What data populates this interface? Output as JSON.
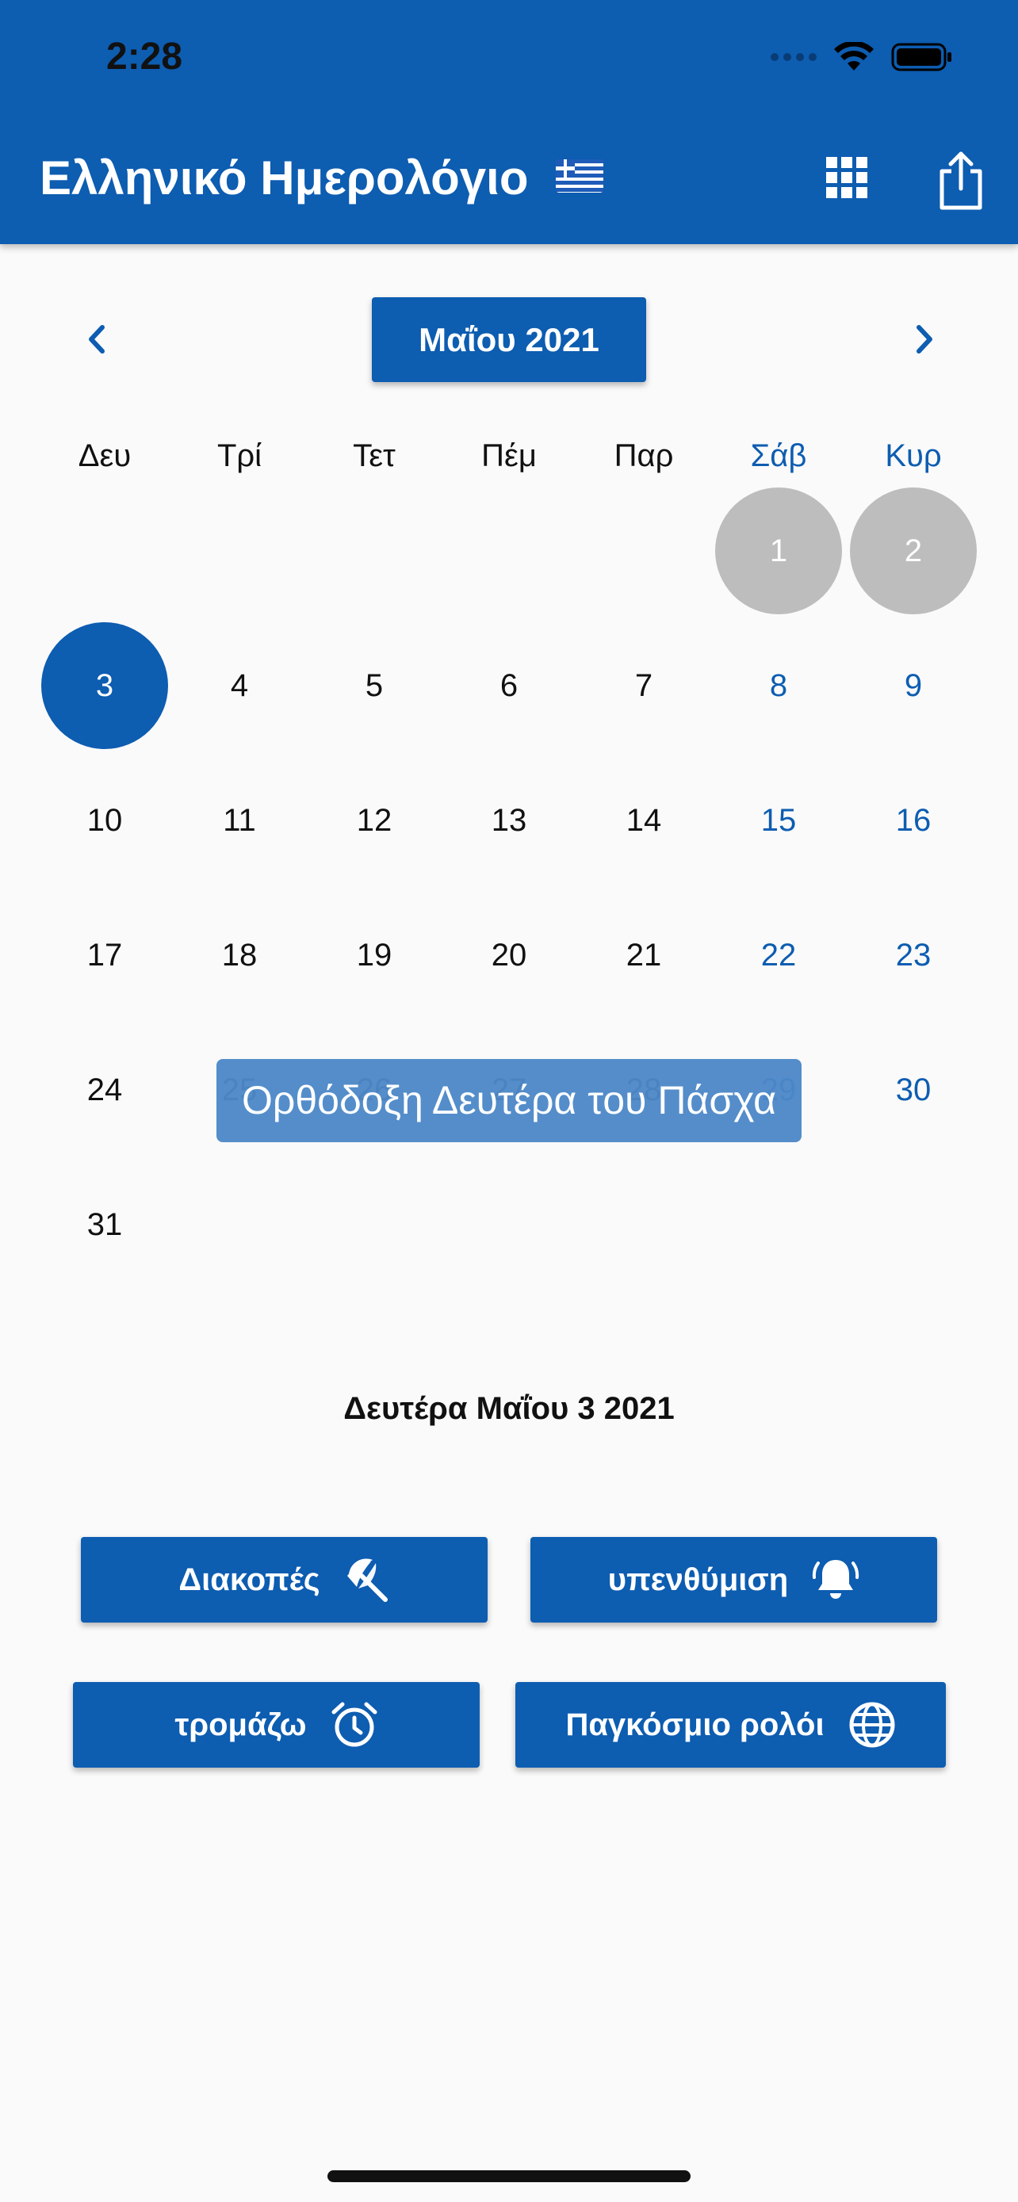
{
  "status_bar": {
    "time": "2:28"
  },
  "app_bar": {
    "title": "Ελληνικό Ημερολόγιο",
    "flag_icon": "greek-flag-icon",
    "grid_icon": "grid-icon",
    "share_icon": "share-icon"
  },
  "calendar": {
    "month_label": "Μαΐου 2021",
    "weekdays": [
      "Δευ",
      "Τρί",
      "Τετ",
      "Πέμ",
      "Παρ",
      "Σάβ",
      "Κυρ"
    ],
    "weeks": [
      [
        "",
        "",
        "",
        "",
        "",
        "1",
        "2"
      ],
      [
        "3",
        "4",
        "5",
        "6",
        "7",
        "8",
        "9"
      ],
      [
        "10",
        "11",
        "12",
        "13",
        "14",
        "15",
        "16"
      ],
      [
        "17",
        "18",
        "19",
        "20",
        "21",
        "22",
        "23"
      ],
      [
        "24",
        "25",
        "26",
        "27",
        "28",
        "29",
        "30"
      ],
      [
        "31",
        "",
        "",
        "",
        "",
        "",
        ""
      ]
    ],
    "holiday_days": [
      "1",
      "2"
    ],
    "selected_day": "3",
    "tooltip": "Ορθόδοξη Δευτέρα του Πάσχα"
  },
  "selected_date": "Δευτέρα Μαΐου 3 2021",
  "actions": {
    "holidays": "Διακοπές",
    "reminder": "υπενθύμιση",
    "alarm": "τρομάζω",
    "world_clock": "Παγκόσμιο ρολόι"
  },
  "colors": {
    "primary": "#0d5db1",
    "holiday_circle": "#bdbdbd",
    "tooltip": "#4d88c8",
    "background": "#fafafa"
  }
}
